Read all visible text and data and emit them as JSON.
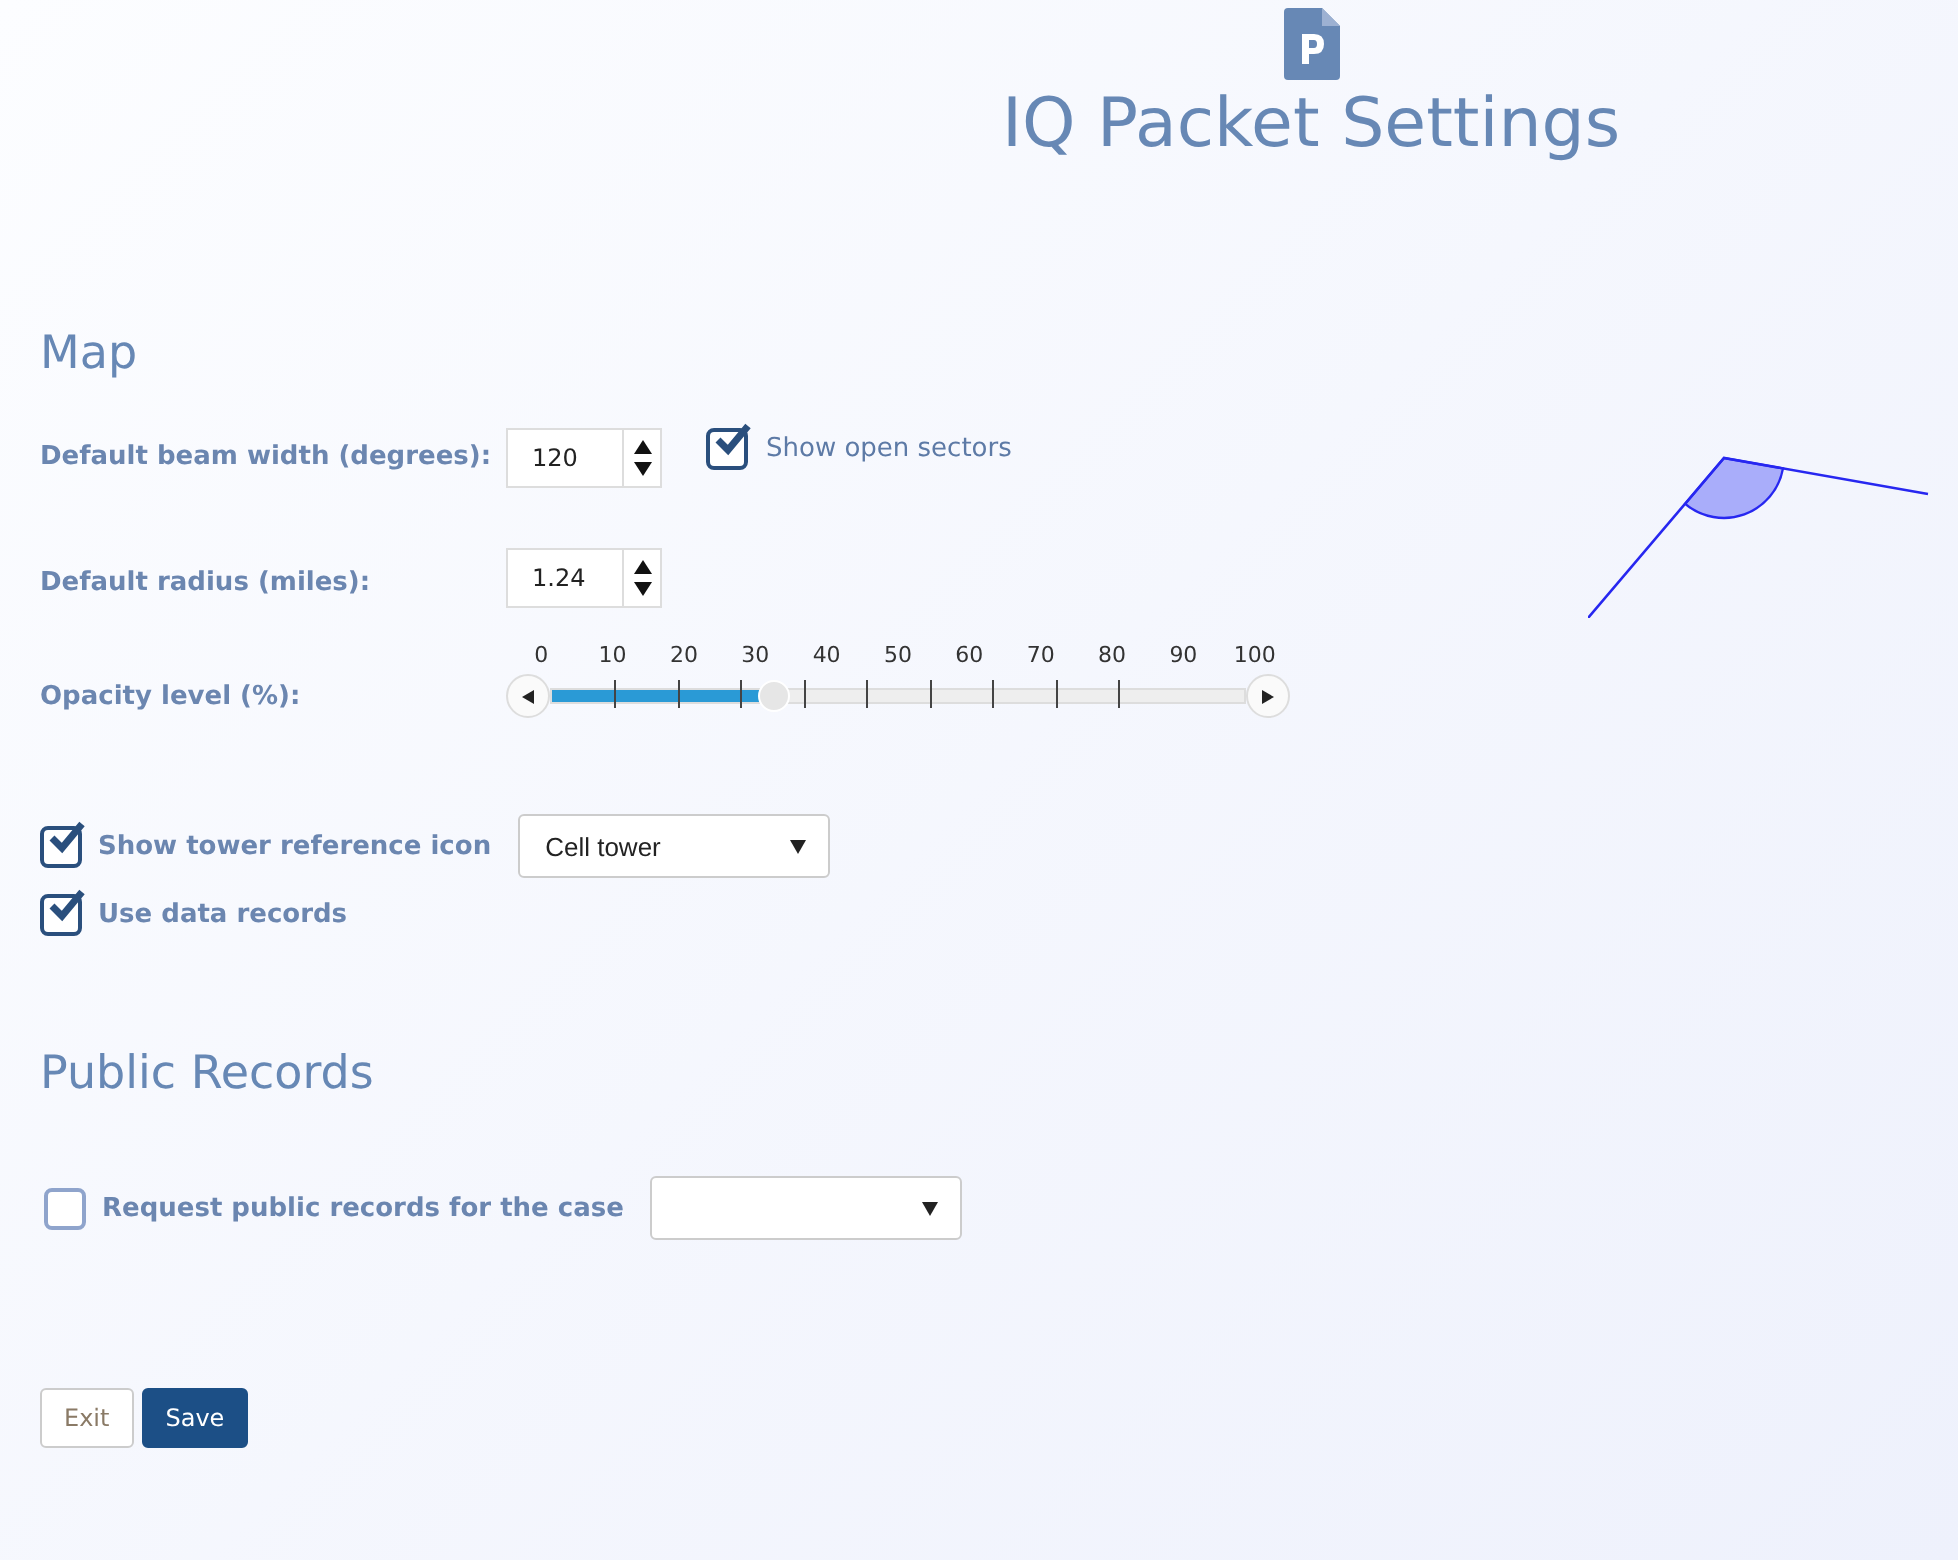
{
  "title": "IQ Packet Settings",
  "map": {
    "heading": "Map",
    "beam_width": {
      "label": "Default beam width (degrees):",
      "value": "120"
    },
    "show_open_sectors": {
      "label": "Show open sectors",
      "checked": true
    },
    "radius": {
      "label": "Default radius (miles):",
      "value": "1.24"
    },
    "opacity": {
      "label": "Opacity level (%):",
      "level": 0.3,
      "ticks": [
        "0",
        "10",
        "20",
        "30",
        "40",
        "50",
        "60",
        "70",
        "80",
        "90",
        "100"
      ]
    },
    "tower_icon": {
      "label": "Show tower reference icon",
      "checked": true,
      "value": "Cell tower"
    },
    "data_records": {
      "label": "Use data records",
      "checked": true
    }
  },
  "public_records": {
    "heading": "Public Records",
    "request": {
      "label": "Request public records for the case",
      "checked": false
    }
  },
  "buttons": [
    {
      "label": "Exit",
      "kind": "secondary"
    },
    {
      "label": "Save",
      "kind": "primary"
    }
  ]
}
